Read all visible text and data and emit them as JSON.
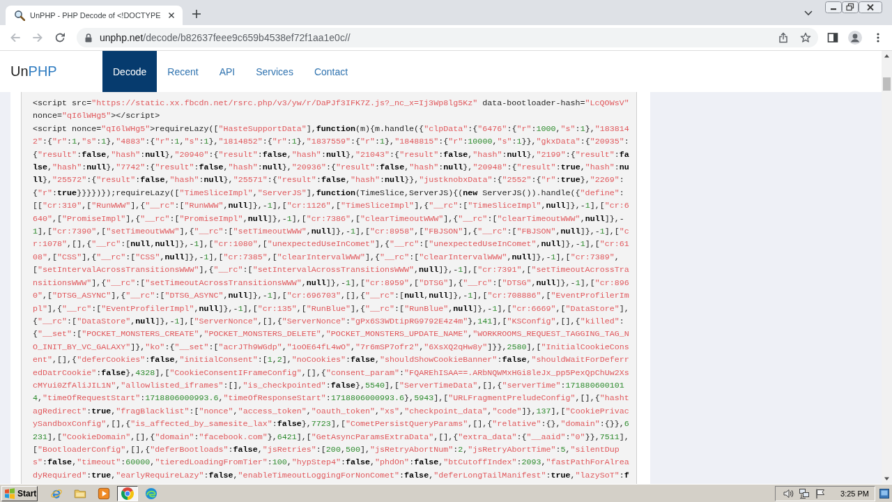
{
  "browser": {
    "tabs": [
      {
        "title": "UnPHP - PHP Decode of <!DOCTYPE",
        "selected": true
      }
    ],
    "toolbar_buttons": [
      {
        "kind": "back",
        "disabled": true
      },
      {
        "kind": "forward",
        "disabled": true
      },
      {
        "kind": "reload",
        "disabled": false
      }
    ],
    "address_bar": {
      "host": "unphp.net",
      "path": "/decode/b82637feee9c659b4538ef72f1aa1e0c//"
    }
  },
  "site_header": {
    "logo": [
      {
        "text": "Un",
        "kind": "plain"
      },
      {
        "text": "PHP",
        "kind": "accent"
      }
    ],
    "nav": [
      {
        "label": "Decode",
        "selected": true
      },
      {
        "label": "Recent",
        "selected": false
      },
      {
        "label": "API",
        "selected": false
      },
      {
        "label": "Services",
        "selected": false
      },
      {
        "label": "Contact",
        "selected": false
      }
    ]
  },
  "code_lines": [
    "<script src=\"https://static.xx.fbcdn.net/rsrc.php/v3/yw/r/DaPJf3IFK7Z.js?_nc_x=Ij3Wp8lg5Kz\" data-bootloader-hash=\"LcQOWsV\"",
    "nonce=\"qI6lWHg5\"></script>",
    "<script nonce=\"qI6lWHg5\">requireLazy([\"HasteSupportData\"],function(m){m.handle({\"clpData\":{\"6476\":{\"r\":1000,\"s\":1},\"183814",
    "2\":{\"r\":1,\"s\":1},\"4883\":{\"r\":1,\"s\":1},\"1814852\":{\"r\":1},\"1837559\":{\"r\":1},\"1848815\":{\"r\":10000,\"s\":1}},\"gkxData\":{\"20935\":",
    "{\"result\":false,\"hash\":null},\"20940\":{\"result\":false,\"hash\":null},\"21043\":{\"result\":false,\"hash\":null},\"2199\":{\"result\":fa",
    "lse,\"hash\":null},\"7742\":{\"result\":false,\"hash\":null},\"20936\":{\"result\":false,\"hash\":null},\"20948\":{\"result\":true,\"hash\":nu",
    "ll},\"25572\":{\"result\":false,\"hash\":null},\"25571\":{\"result\":false,\"hash\":null}},\"justknobxData\":{\"2552\":{\"r\":true},\"2269\":",
    "{\"r\":true}}}})});requireLazy([\"TimeSliceImpl\",\"ServerJS\"],function(TimeSlice,ServerJS){(new ServerJS()).handle({\"define\":",
    "[[\"cr:310\",[\"RunWWW\"],{\"__rc\":[\"RunWWW\",null]},-1],[\"cr:1126\",[\"TimeSliceImpl\"],{\"__rc\":[\"TimeSliceImpl\",null]},-1],[\"cr:6",
    "640\",[\"PromiseImpl\"],{\"__rc\":[\"PromiseImpl\",null]},-1],[\"cr:7386\",[\"clearTimeoutWWW\"],{\"__rc\":[\"clearTimeoutWWW\",null]},-",
    "1],[\"cr:7390\",[\"setTimeoutWWW\"],{\"__rc\":[\"setTimeoutWWW\",null]},-1],[\"cr:8958\",[\"FBJSON\"],{\"__rc\":[\"FBJSON\",null]},-1],[\"c",
    "r:1078\",[],{\"__rc\":[null,null]},-1],[\"cr:1080\",[\"unexpectedUseInComet\"],{\"__rc\":[\"unexpectedUseInComet\",null]},-1],[\"cr:61",
    "08\",[\"CSS\"],{\"__rc\":[\"CSS\",null]},-1],[\"cr:7385\",[\"clearIntervalWWW\"],{\"__rc\":[\"clearIntervalWWW\",null]},-1],[\"cr:7389\",",
    "[\"setIntervalAcrossTransitionsWWW\"],{\"__rc\":[\"setIntervalAcrossTransitionsWWW\",null]},-1],[\"cr:7391\",[\"setTimeoutAcrossTra",
    "nsitionsWWW\"],{\"__rc\":[\"setTimeoutAcrossTransitionsWWW\",null]},-1],[\"cr:8959\",[\"DTSG\"],{\"__rc\":[\"DTSG\",null]},-1],[\"cr:896",
    "0\",[\"DTSG_ASYNC\"],{\"__rc\":[\"DTSG_ASYNC\",null]},-1],[\"cr:696703\",[],{\"__rc\":[null,null]},-1],[\"cr:708886\",[\"EventProfilerIm",
    "pl\"],{\"__rc\":[\"EventProfilerImpl\",null]},-1],[\"cr:135\",[\"RunBlue\"],{\"__rc\":[\"RunBlue\",null]},-1],[\"cr:6669\",[\"DataStore\"],",
    "{\"__rc\":[\"DataStore\",null]},-1],[\"ServerNonce\",[],{\"ServerNonce\":\"gPx6S3WDtipRG9792E4z4m\"},141],[\"KSConfig\",[],{\"killed\":",
    "{\"__set\":[\"POCKET_MONSTERS_CREATE\",\"POCKET_MONSTERS_DELETE\",\"POCKET_MONSTERS_UPDATE_NAME\",\"WORKROOMS_REQUEST_TAGGING_TAG_N",
    "O_INIT_BY_VC_GALAXY\"]},\"ko\":{\"__set\":[\"acrJTh9WGdp\",\"1oOE64fL4wO\",\"7r6mSP7ofr2\",\"6XsXQ2qHw8y\"]}},2580],[\"InitialCookieCons",
    "ent\",[],{\"deferCookies\":false,\"initialConsent\":[1,2],\"noCookies\":false,\"shouldShowCookieBanner\":false,\"shouldWaitForDeferr",
    "edDatrCookie\":false},4328],[\"CookieConsentIFrameConfig\",[],{\"consent_param\":\"FQAREhISAA==.ARbNQWMxHGi8leJx_pp5PexQpChUw2Xs",
    "cMYui0ZfAliJIL1N\",\"allowlisted_iframes\":[],\"is_checkpointed\":false},5540],[\"ServerTimeData\",[],{\"serverTime\":171880600101",
    "4,\"timeOfRequestStart\":1718806000993.6,\"timeOfResponseStart\":1718806000993.6},5943],[\"URLFragmentPreludeConfig\",[],{\"hasht",
    "agRedirect\":true,\"fragBlacklist\":[\"nonce\",\"access_token\",\"oauth_token\",\"xs\",\"checkpoint_data\",\"code\"]},137],[\"CookiePrivac",
    "ySandboxConfig\",[],{\"is_affected_by_samesite_lax\":false},7723],[\"CometPersistQueryParams\",[],{\"relative\":{},\"domain\":{}},6",
    "231],[\"CookieDomain\",[],{\"domain\":\"facebook.com\"},6421],[\"GetAsyncParamsExtraData\",[],{\"extra_data\":{\"__aaid\":\"0\"}},7511],",
    "[\"BootloaderConfig\",[],{\"deferBootloads\":false,\"jsRetries\":[200,500],\"jsRetryAbortNum\":2,\"jsRetryAbortTime\":5,\"silentDup",
    "s\":false,\"timeout\":60000,\"tieredLoadingFromTier\":100,\"hypStep4\":false,\"phdOn\":false,\"btCutoffIndex\":2093,\"fastPathForAlrea",
    "dyRequired\":true,\"earlyRequireLazy\":false,\"enableTimeoutLoggingForNonComet\":false,\"deferLongTailManifest\":true,\"lazySoT\":f"
  ],
  "taskbar": {
    "start_label": "Start",
    "apps": [
      {
        "kind": "ie",
        "selected": false
      },
      {
        "kind": "folder",
        "selected": false
      },
      {
        "kind": "media",
        "selected": false
      },
      {
        "kind": "chrome",
        "selected": true
      },
      {
        "kind": "edge",
        "selected": false
      }
    ],
    "clock": "3:25 PM"
  }
}
